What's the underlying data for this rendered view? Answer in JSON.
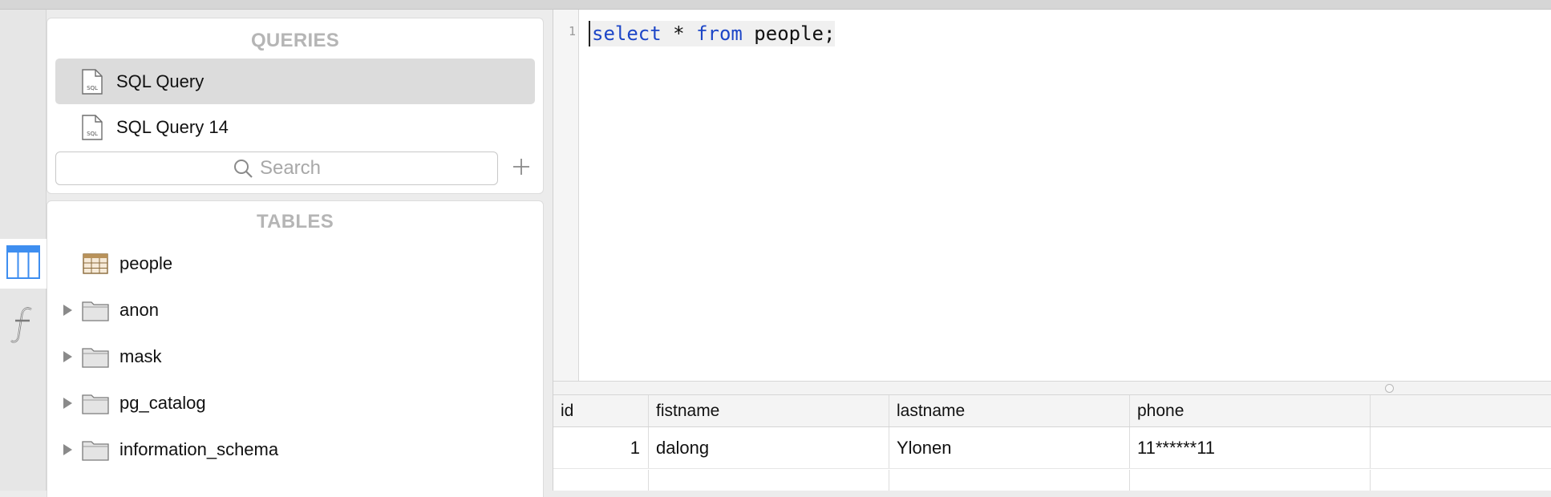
{
  "sidebar": {
    "queries_title": "QUERIES",
    "queries": [
      {
        "label": "SQL Query",
        "selected": true
      },
      {
        "label": "SQL Query 14",
        "selected": false
      }
    ],
    "search_placeholder": "Search",
    "tables_title": "TABLES",
    "tables": [
      {
        "label": "people",
        "type": "table",
        "expandable": false
      },
      {
        "label": "anon",
        "type": "schema",
        "expandable": true
      },
      {
        "label": "mask",
        "type": "schema",
        "expandable": true
      },
      {
        "label": "pg_catalog",
        "type": "schema",
        "expandable": true
      },
      {
        "label": "information_schema",
        "type": "schema",
        "expandable": true
      }
    ]
  },
  "editor": {
    "line_number": "1",
    "tokens": {
      "select": "select",
      "star": " * ",
      "from": "from",
      "rest": " people;"
    }
  },
  "results": {
    "columns": [
      "id",
      "fistname",
      "lastname",
      "phone",
      ""
    ],
    "rows": [
      {
        "id": "1",
        "fistname": "dalong",
        "lastname": "Ylonen",
        "phone": "11******11"
      }
    ]
  },
  "colors": {
    "keyword": "#1d46c7",
    "selected_row": "#dcdcdc",
    "tables_tab_icon": "#3e8ef0"
  }
}
